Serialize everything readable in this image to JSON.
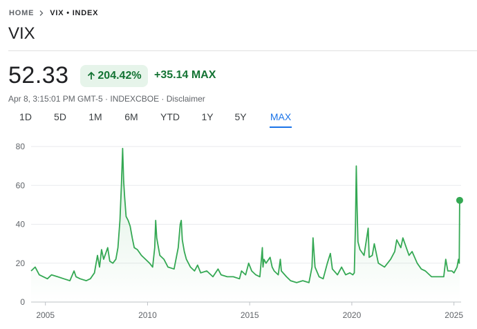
{
  "breadcrumb": {
    "home": "HOME",
    "current": "VIX • INDEX"
  },
  "title": "VIX",
  "quote": {
    "price": "52.33",
    "change_pct": "204.42%",
    "change_abs": "+35.14 MAX",
    "meta": "Apr 8, 3:15:01 PM GMT-5 · INDEXCBOE · Disclaimer"
  },
  "tabs": [
    {
      "label": "1D"
    },
    {
      "label": "5D"
    },
    {
      "label": "1M"
    },
    {
      "label": "6M"
    },
    {
      "label": "YTD"
    },
    {
      "label": "1Y"
    },
    {
      "label": "5Y"
    },
    {
      "label": "MAX"
    }
  ],
  "active_tab": "MAX",
  "colors": {
    "line": "#34a853",
    "up": "#137333",
    "badge_bg": "#e6f4ea",
    "active_tab": "#1a73e8"
  },
  "icons": {
    "breadcrumb_sep": "chevron-right-icon",
    "change": "arrow-up-icon"
  },
  "chart_data": {
    "type": "area",
    "ylim": [
      0,
      80
    ],
    "yticks": [
      "80",
      "60",
      "40",
      "20",
      "0"
    ],
    "yticks_values": [
      80,
      60,
      40,
      20,
      0
    ],
    "xticks": [
      "2005",
      "2010",
      "2015",
      "2020",
      "2025"
    ],
    "xticks_values": [
      2005,
      2010,
      2015,
      2020,
      2025
    ],
    "xlim": [
      2004.3,
      2025.35
    ],
    "grid": true,
    "series": [
      {
        "x": [
          2004.3,
          2004.5,
          2004.7,
          2004.9,
          2005.1,
          2005.3,
          2005.6,
          2005.9,
          2006.2,
          2006.4,
          2006.5,
          2006.7,
          2007.0,
          2007.2,
          2007.4,
          2007.55,
          2007.65,
          2007.75,
          2007.85,
          2007.95,
          2008.05,
          2008.15,
          2008.3,
          2008.45,
          2008.55,
          2008.65,
          2008.72,
          2008.78,
          2008.83,
          2008.88,
          2008.95,
          2009.05,
          2009.15,
          2009.25,
          2009.35,
          2009.5,
          2009.7,
          2009.9,
          2010.1,
          2010.25,
          2010.35,
          2010.4,
          2010.45,
          2010.6,
          2010.8,
          2011.0,
          2011.3,
          2011.5,
          2011.6,
          2011.65,
          2011.7,
          2011.8,
          2011.9,
          2012.1,
          2012.3,
          2012.45,
          2012.6,
          2012.9,
          2013.2,
          2013.45,
          2013.6,
          2013.9,
          2014.2,
          2014.5,
          2014.6,
          2014.8,
          2014.95,
          2015.1,
          2015.3,
          2015.5,
          2015.62,
          2015.65,
          2015.7,
          2015.8,
          2016.0,
          2016.1,
          2016.2,
          2016.4,
          2016.5,
          2016.55,
          2016.8,
          2017.0,
          2017.3,
          2017.6,
          2017.9,
          2018.05,
          2018.1,
          2018.2,
          2018.4,
          2018.6,
          2018.8,
          2018.95,
          2019.05,
          2019.3,
          2019.5,
          2019.7,
          2019.9,
          2020.05,
          2020.12,
          2020.18,
          2020.22,
          2020.26,
          2020.3,
          2020.4,
          2020.6,
          2020.8,
          2020.85,
          2021.0,
          2021.1,
          2021.3,
          2021.6,
          2021.9,
          2022.1,
          2022.2,
          2022.4,
          2022.5,
          2022.7,
          2022.8,
          2022.95,
          2023.2,
          2023.4,
          2023.6,
          2023.9,
          2024.2,
          2024.5,
          2024.6,
          2024.7,
          2024.9,
          2025.0,
          2025.15,
          2025.22,
          2025.26,
          2025.28
        ],
        "y": [
          16,
          18,
          14,
          13,
          12,
          14,
          13,
          12,
          11,
          16,
          13,
          12,
          11,
          12,
          15,
          24,
          18,
          27,
          22,
          25,
          28,
          21,
          20,
          22,
          28,
          42,
          60,
          79,
          62,
          54,
          44,
          42,
          39,
          33,
          28,
          27,
          24,
          22,
          20,
          18,
          28,
          42,
          33,
          24,
          22,
          18,
          17,
          28,
          40,
          42,
          32,
          26,
          22,
          18,
          16,
          19,
          15,
          16,
          13,
          17,
          14,
          13,
          13,
          12,
          16,
          14,
          20,
          16,
          14,
          13,
          28,
          18,
          22,
          20,
          23,
          18,
          16,
          14,
          22,
          16,
          13,
          11,
          10,
          11,
          10,
          18,
          33,
          18,
          13,
          12,
          20,
          25,
          17,
          14,
          18,
          14,
          15,
          14,
          15,
          40,
          70,
          48,
          31,
          27,
          24,
          38,
          23,
          24,
          30,
          20,
          18,
          22,
          26,
          32,
          28,
          33,
          27,
          24,
          26,
          20,
          17,
          16,
          13,
          13,
          13,
          22,
          16,
          16,
          15,
          18,
          22,
          20,
          52.33
        ]
      }
    ]
  }
}
